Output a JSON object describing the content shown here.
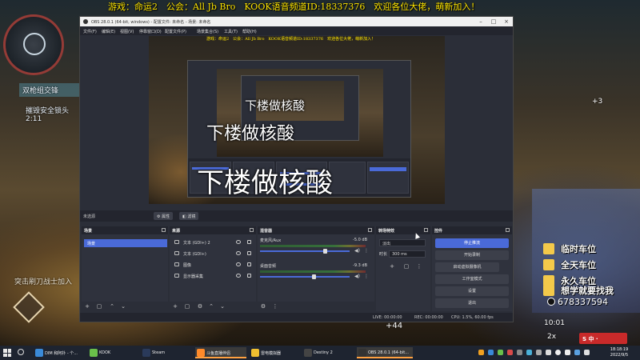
{
  "stream": {
    "marquee": "游戏：命运2　公会：All Jb Bro　KOOK语音频道ID:18337376　欢迎各位大佬，萌新加入！"
  },
  "game_hud": {
    "objective_title": "双枪组交锋",
    "objective_line1": "摧毁安全锁头",
    "objective_timer": "2:11",
    "bottom_left_text": "突击刷刀战士加入",
    "plus3": "+3",
    "plus44": "+44",
    "time2": "10:01",
    "score2x": "2x"
  },
  "donations": {
    "rows": [
      {
        "text": "临时车位"
      },
      {
        "text": "全天车位"
      },
      {
        "text": "永久车位"
      },
      {
        "text": "想学就要找我"
      }
    ],
    "qq": "678337594",
    "logo": "S 中 ·"
  },
  "obs": {
    "title": "OBS 28.0.1 (64-bit, windows) - 配置文件: 未命名 - 场景: 未命名",
    "menu": [
      "文件(F)",
      "编辑(E)",
      "视图(V)",
      "停靠窗口(D)",
      "配置文件(P)",
      "场景集合(S)",
      "工具(T)",
      "帮助(H)"
    ],
    "preview_marquee": "游戏：命运2　公会：All Jb Bro　KOOK语音频道ID:18337376　欢迎各位大佬，萌新加入！",
    "overlay_texts": [
      "下楼做核酸",
      "下楼做核酸",
      "下楼做核酸"
    ],
    "source_bar": {
      "label": "未选源",
      "properties": "属性",
      "filters": "滤镜"
    },
    "scenes": {
      "title": "场景",
      "items": [
        "场景"
      ]
    },
    "sources": {
      "title": "来源",
      "items": [
        {
          "name": "文本 (GDI+) 2"
        },
        {
          "name": "文本 (GDI+)"
        },
        {
          "name": "图像"
        },
        {
          "name": "显示器采集"
        }
      ]
    },
    "mixer": {
      "title": "混音器",
      "tracks": [
        {
          "name": "麦克风/Aux",
          "db": "-5.0 dB",
          "level": 0.72
        },
        {
          "name": "桌面音频",
          "db": "-9.3 dB",
          "level": 0.6
        }
      ]
    },
    "transitions": {
      "title": "转场特效",
      "type": "淡出",
      "duration_label": "时长",
      "duration_value": "300 ms"
    },
    "controls": {
      "title": "控件",
      "buttons": [
        "停止推流",
        "开始录制",
        "启动虚拟摄像机",
        "工作室模式",
        "设置",
        "退出"
      ]
    },
    "status": {
      "live": "LIVE: 00:00:00",
      "rec": "REC: 00:00:00",
      "cpu": "CPU: 1.5%, 60.00 fps"
    }
  },
  "taskbar": {
    "apps": [
      {
        "label": "DIM 和阿扑 - 个...",
        "color": "#3a8ad8"
      },
      {
        "label": "KOOK",
        "color": "#6ac04a"
      },
      {
        "label": "Steam",
        "color": "#2a3a5a"
      },
      {
        "label": "斗鱼直播伴侣",
        "color": "#ff8a2a"
      },
      {
        "label": "雷电模拟器",
        "color": "#f0c030"
      },
      {
        "label": "Destiny 2",
        "color": "#444"
      },
      {
        "label": "OBS 28.0.1 (64-bit...",
        "color": "#333"
      }
    ],
    "time": "18:18:19",
    "date": "2022/9/5"
  }
}
